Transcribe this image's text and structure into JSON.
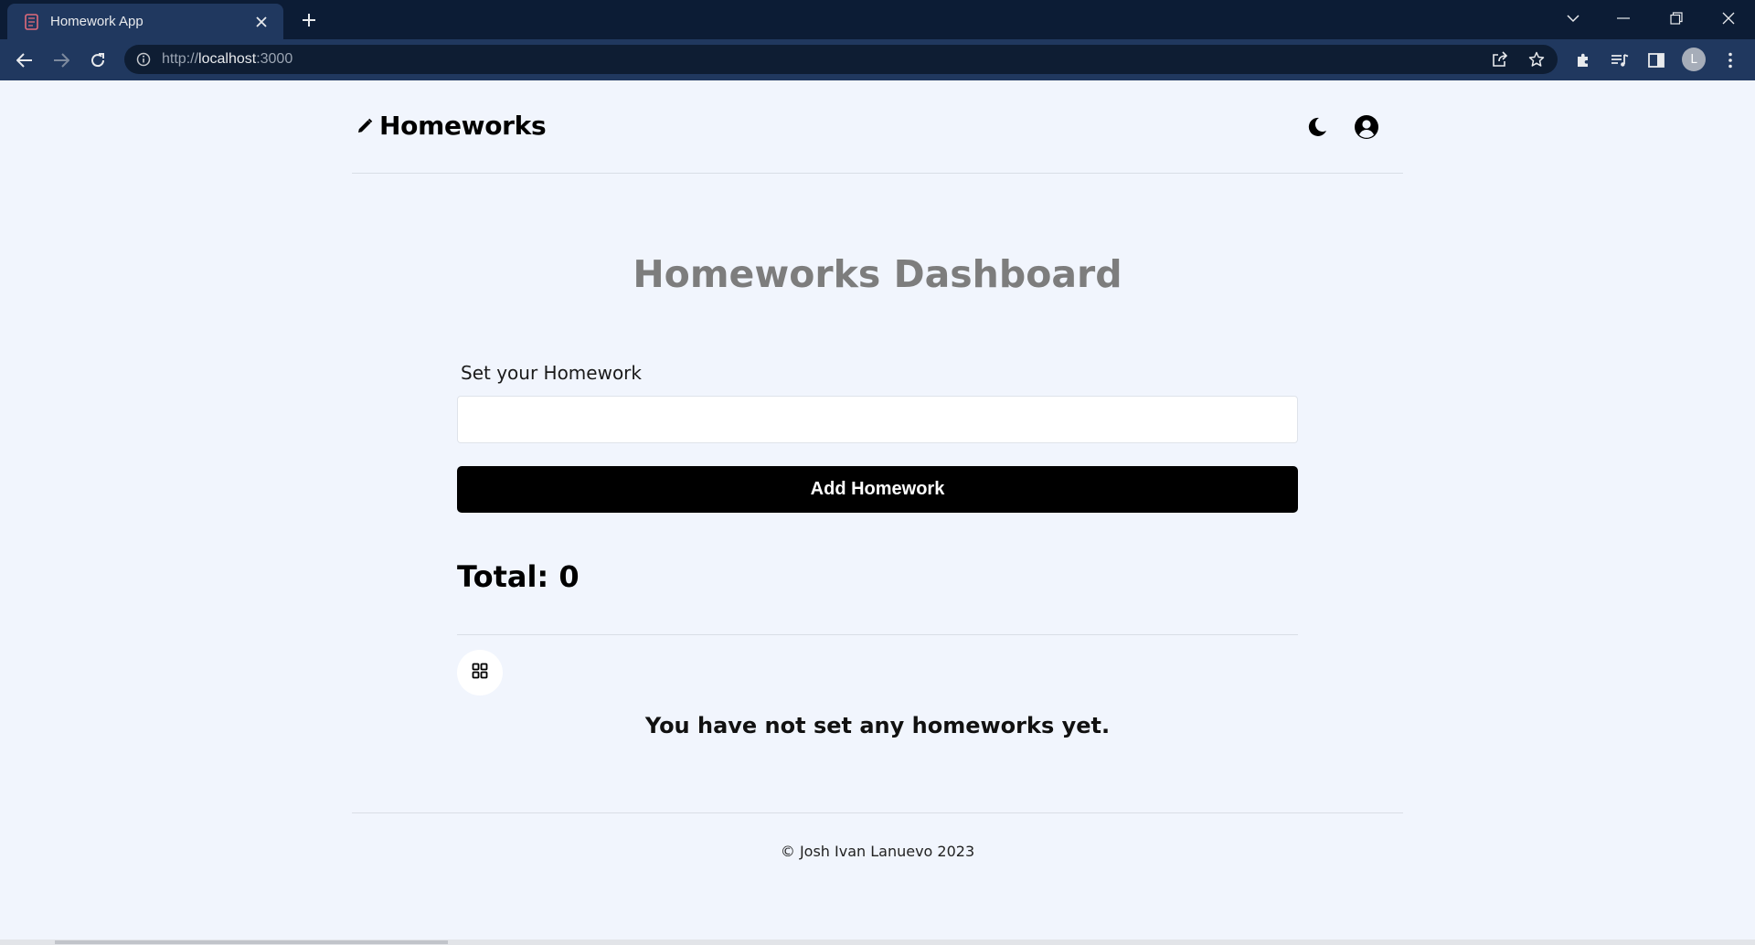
{
  "browser": {
    "tab_title": "Homework App",
    "url_scheme": "http://",
    "url_host": "localhost",
    "url_port": ":3000",
    "profile_initial": "L",
    "icons": [
      "notebook-favicon",
      "close-icon",
      "plus-icon",
      "chevron-down-icon",
      "minimize-icon",
      "restore-icon",
      "close-window-icon",
      "back-arrow-icon",
      "forward-arrow-icon",
      "reload-icon",
      "info-icon",
      "share-icon",
      "star-icon",
      "puzzle-icon",
      "media-icon",
      "side-panel-icon"
    ]
  },
  "navbar": {
    "brand": "Homeworks",
    "icons": [
      "pencil-icon",
      "moon-icon",
      "user-circle-icon"
    ]
  },
  "main": {
    "title": "Homeworks Dashboard",
    "form_label": "Set your Homework",
    "input_value": "",
    "add_button": "Add Homework",
    "total_label": "Total: 0",
    "empty_message": "You have not set any homeworks yet."
  },
  "footer": {
    "text": "© Josh Ivan Lanuevo 2023"
  },
  "colors": {
    "chrome_dark": "#0c1c35",
    "chrome_toolbar": "#20385f",
    "page_bg": "#f1f5fd",
    "title_gray": "#7d7d7d",
    "button_black": "#000000"
  }
}
